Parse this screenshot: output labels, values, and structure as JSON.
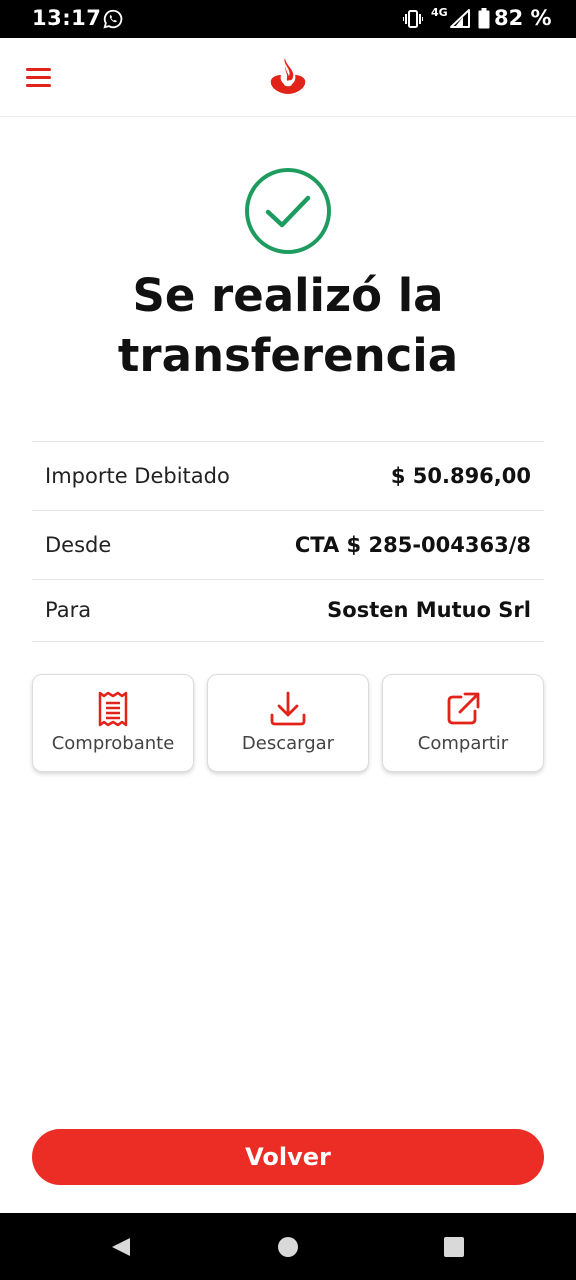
{
  "status_bar": {
    "time": "13:17",
    "network": "4G",
    "battery": "82 %",
    "icons": [
      "whatsapp-icon",
      "vibrate-icon",
      "signal-icon",
      "battery-icon"
    ]
  },
  "header": {
    "menu_icon": "menu-icon",
    "logo_icon": "santander-flame-icon"
  },
  "success": {
    "icon": "check-circle-icon",
    "title_line_1": "Se realizó la",
    "title_line_2": "transferencia"
  },
  "details": [
    {
      "label": "Importe Debitado",
      "value": "$ 50.896,00"
    },
    {
      "label": "Desde",
      "value": "CTA $ 285-004363/8"
    },
    {
      "label": "Para",
      "value": "Sosten Mutuo Srl"
    }
  ],
  "actions": [
    {
      "label": "Comprobante",
      "icon": "receipt-icon"
    },
    {
      "label": "Descargar",
      "icon": "download-icon"
    },
    {
      "label": "Compartir",
      "icon": "share-icon"
    }
  ],
  "primary_button": {
    "label": "Volver"
  },
  "colors": {
    "brand": "#ec2d25",
    "success": "#1e9b5f",
    "text": "#111111"
  }
}
